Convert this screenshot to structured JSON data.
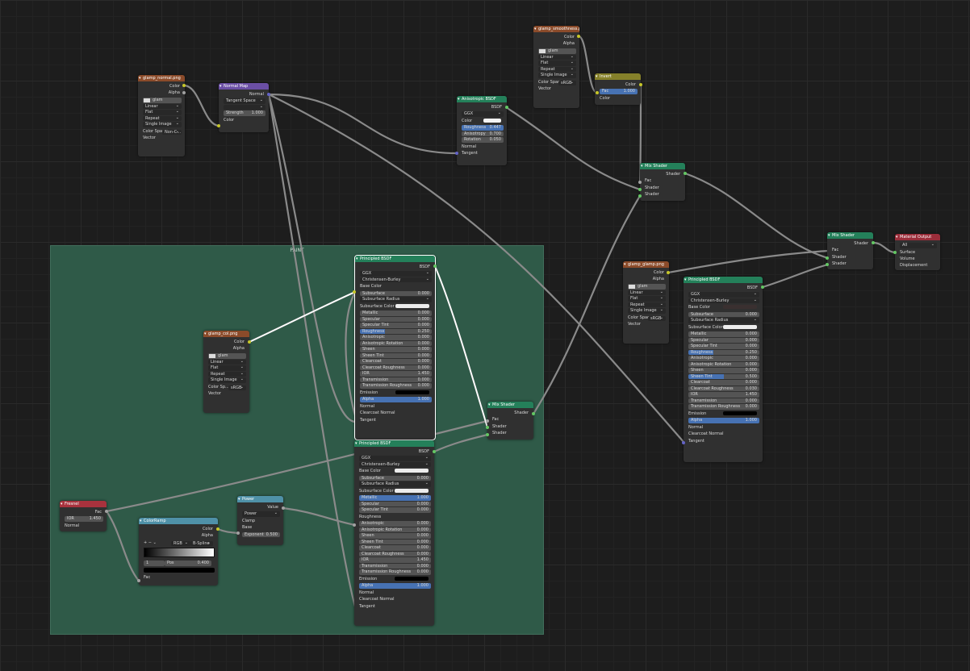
{
  "frame": {
    "label": "PAINT"
  },
  "nodes": {
    "tex_normal": {
      "title": "glamp_normal.png",
      "out_color": "Color",
      "out_alpha": "Alpha",
      "img": "glam",
      "interp": "Linear",
      "proj": "Flat",
      "ext": "Repeat",
      "src": "Single Image",
      "cs_label": "Color Spac",
      "cs_val": "Non-C...",
      "in_vector": "Vector"
    },
    "normal_map": {
      "title": "Normal Map",
      "out_normal": "Normal",
      "space": "Tangent Space",
      "uv": "",
      "strength_label": "Strength",
      "strength_val": "1.000",
      "in_color": "Color"
    },
    "aniso": {
      "title": "Anisotropic BSDF",
      "out_bsdf": "BSDF",
      "dist": "GGX",
      "color": "Color",
      "rough_label": "Roughness",
      "rough_val": "0.447",
      "aniso_label": "Anisotropy",
      "aniso_val": "0.700",
      "rot_label": "Rotation",
      "rot_val": "0.050",
      "in_normal": "Normal",
      "in_tangent": "Tangent"
    },
    "tex_smooth": {
      "title": "glamp_smoothness.png",
      "out_color": "Color",
      "out_alpha": "Alpha",
      "img": "glam",
      "interp": "Linear",
      "proj": "Flat",
      "ext": "Repeat",
      "src": "Single Image",
      "cs_label": "Color Spac",
      "cs_val": "sRGB",
      "in_vector": "Vector"
    },
    "invert": {
      "title": "Invert",
      "out_color": "Color",
      "fac_label": "Fac",
      "fac_val": "1.000",
      "in_color": "Color"
    },
    "mix1": {
      "title": "Mix Shader",
      "out_shader": "Shader",
      "in_fac": "Fac",
      "in_s1": "Shader",
      "in_s2": "Shader"
    },
    "mix_final": {
      "title": "Mix Shader",
      "out_shader": "Shader",
      "in_fac": "Fac",
      "in_s1": "Shader",
      "in_s2": "Shader"
    },
    "mat_out": {
      "title": "Material Output",
      "target": "All",
      "in_surface": "Surface",
      "in_volume": "Volume",
      "in_disp": "Displacement"
    },
    "tex_glamp": {
      "title": "glamp_glamp.png",
      "out_color": "Color",
      "out_alpha": "Alpha",
      "img": "glam",
      "interp": "Linear",
      "proj": "Flat",
      "ext": "Repeat",
      "src": "Single Image",
      "cs_label": "Color Spac",
      "cs_val": "sRGB",
      "in_vector": "Vector"
    },
    "tex_col": {
      "title": "glamp_col.png",
      "out_color": "Color",
      "out_alpha": "Alpha",
      "img": "glam",
      "interp": "Linear",
      "proj": "Flat",
      "ext": "Repeat",
      "src": "Single Image",
      "cs_label": "Color Sp...",
      "cs_val": "sRGB",
      "in_vector": "Vector"
    },
    "mix_paint": {
      "title": "Mix Shader",
      "out_shader": "Shader",
      "in_fac": "Fac",
      "in_s1": "Shader",
      "in_s2": "Shader"
    },
    "fresnel": {
      "title": "Fresnel",
      "out_fac": "Fac",
      "ior_label": "IOR",
      "ior_val": "1.450",
      "in_normal": "Normal"
    },
    "power": {
      "title": "Power",
      "out_value": "Value",
      "op": "Power",
      "clamp": "Clamp",
      "base": "Base",
      "exp_label": "Exponent",
      "exp_val": "0.500"
    },
    "colorramp": {
      "title": "ColorRamp",
      "out_color": "Color",
      "out_alpha": "Alpha",
      "mode": "RGB",
      "interp": "B-Spline",
      "idx": "1",
      "pos_label": "Pos",
      "pos_val": "0.400",
      "in_fac": "Fac"
    }
  },
  "principled": {
    "out": "BSDF",
    "dist": "GGX",
    "sss": "Christensen-Burley",
    "inputs": {
      "base_color": "Base Color",
      "subsurface": "Subsurface",
      "sub_radius": "Subsurface Radius",
      "sub_color": "Subsurface Color",
      "metallic": "Metallic",
      "specular": "Specular",
      "spec_tint": "Specular Tint",
      "roughness": "Roughness",
      "anisotropic": "Anisotropic",
      "aniso_rot": "Anisotropic Rotation",
      "sheen": "Sheen",
      "sheen_tint": "Sheen Tint",
      "clearcoat": "Clearcoat",
      "cc_rough": "Clearcoat Roughness",
      "ior": "IOR",
      "transmission": "Transmission",
      "trans_rough": "Transmission Roughness",
      "emission": "Emission",
      "alpha": "Alpha",
      "normal": "Normal",
      "cc_normal": "Clearcoat Normal",
      "tangent": "Tangent"
    },
    "top": {
      "title": "Principled BSDF",
      "subsurface": "0.000",
      "metallic": "0.000",
      "specular": "0.000",
      "spec_tint": "0.000",
      "roughness": "0.250",
      "anisotropic": "0.000",
      "aniso_rot": "0.000",
      "sheen": "0.000",
      "sheen_tint": "0.000",
      "clearcoat": "0.000",
      "cc_rough": "0.000",
      "ior": "1.450",
      "transmission": "0.000",
      "trans_rough": "0.000",
      "alpha": "1.000"
    },
    "bottom": {
      "title": "Principled BSDF",
      "subsurface": "0.000",
      "metallic": "1.000",
      "specular": "0.000",
      "spec_tint": "0.000",
      "anisotropic": "0.000",
      "aniso_rot": "0.000",
      "sheen": "0.000",
      "sheen_tint": "0.000",
      "clearcoat": "0.000",
      "cc_rough": "0.000",
      "ior": "1.450",
      "transmission": "0.000",
      "trans_rough": "0.000",
      "alpha": "1.000"
    },
    "right": {
      "title": "Principled BSDF",
      "subsurface": "0.000",
      "metallic": "0.000",
      "specular": "0.000",
      "spec_tint": "0.000",
      "roughness": "0.250",
      "anisotropic": "0.000",
      "aniso_rot": "0.000",
      "sheen": "0.000",
      "sheen_tint": "0.500",
      "clearcoat": "0.000",
      "cc_rough": "0.030",
      "ior": "1.450",
      "transmission": "0.000",
      "trans_rough": "0.000",
      "alpha": "1.000"
    }
  }
}
